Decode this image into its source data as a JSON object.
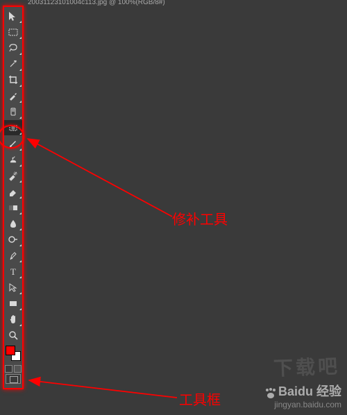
{
  "document": {
    "tab_title": "20031123101004c113.jpg @ 100%(RGB/8#)"
  },
  "annotations": {
    "patch_tool_label": "修补工具",
    "toolbar_label": "工具框"
  },
  "watermark": {
    "brand": "Baidu 经验",
    "url": "jingyan.baidu.com",
    "xzb": "下载吧"
  },
  "tools": [
    {
      "name": "move-tool"
    },
    {
      "name": "rectangular-marquee-tool"
    },
    {
      "name": "lasso-tool"
    },
    {
      "name": "magic-wand-tool"
    },
    {
      "name": "crop-tool"
    },
    {
      "name": "eyedropper-tool"
    },
    {
      "name": "spot-healing-brush-tool"
    },
    {
      "name": "patch-tool"
    },
    {
      "name": "brush-tool"
    },
    {
      "name": "clone-stamp-tool"
    },
    {
      "name": "history-brush-tool"
    },
    {
      "name": "eraser-tool"
    },
    {
      "name": "gradient-tool"
    },
    {
      "name": "blur-tool"
    },
    {
      "name": "dodge-tool"
    },
    {
      "name": "pen-tool"
    },
    {
      "name": "type-tool"
    },
    {
      "name": "path-selection-tool"
    },
    {
      "name": "rectangle-tool"
    },
    {
      "name": "hand-tool"
    },
    {
      "name": "zoom-tool"
    }
  ],
  "colors": {
    "foreground": "#ff0000",
    "background": "#ffffff"
  }
}
